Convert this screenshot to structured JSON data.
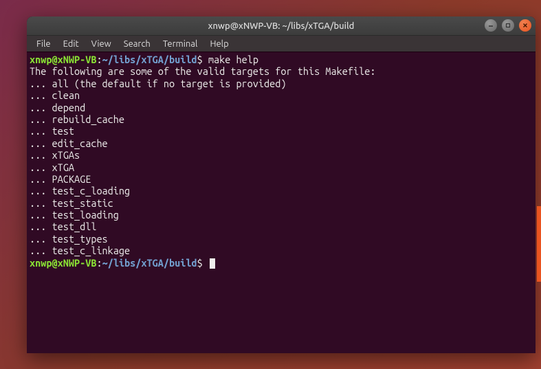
{
  "window": {
    "title": "xnwp@xNWP-VB: ~/libs/xTGA/build"
  },
  "menubar": {
    "items": [
      "File",
      "Edit",
      "View",
      "Search",
      "Terminal",
      "Help"
    ]
  },
  "prompt": {
    "user_host": "xnwp@xNWP-VB",
    "separator": ":",
    "path": "~/libs/xTGA/build",
    "symbol": "$"
  },
  "terminal": {
    "command": "make help",
    "header_line": "The following are some of the valid targets for this Makefile:",
    "targets": [
      "all (the default if no target is provided)",
      "clean",
      "depend",
      "rebuild_cache",
      "test",
      "edit_cache",
      "xTGAs",
      "xTGA",
      "PACKAGE",
      "test_c_loading",
      "test_static",
      "test_loading",
      "test_dll",
      "test_types",
      "test_c_linkage"
    ],
    "target_prefix": "... "
  }
}
